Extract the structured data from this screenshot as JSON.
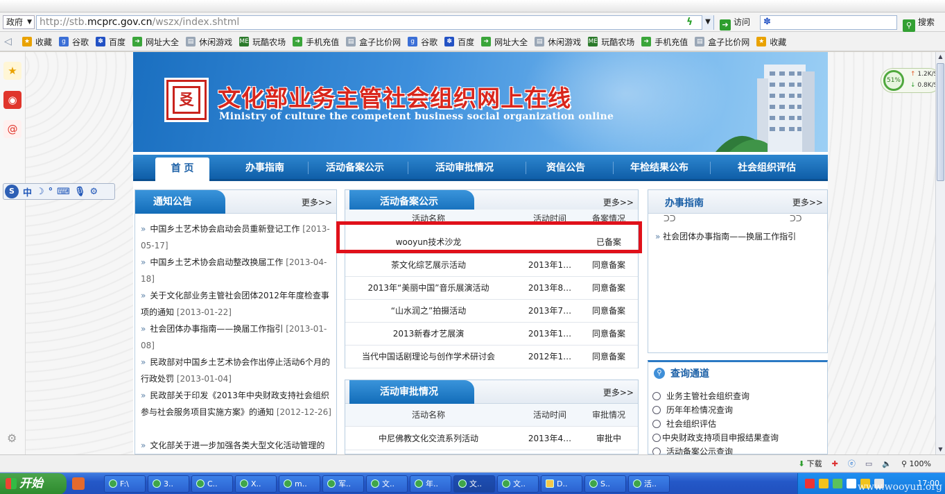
{
  "browser": {
    "gov_label": "政府",
    "url_prefix": "http://stb.",
    "url_domain": "mcprc.gov.cn",
    "url_path": "/wszx/index.shtml",
    "go_label": "访问",
    "search_label": "搜索"
  },
  "favorites": [
    {
      "label": "收藏",
      "icon": "star-icon",
      "color": "#e9a200"
    },
    {
      "label": "谷歌",
      "icon": "google-icon",
      "color": "#3b6fd6"
    },
    {
      "label": "百度",
      "icon": "baidu-paw-icon",
      "color": "#2352c4"
    },
    {
      "label": "网址大全",
      "icon": "hao123-icon",
      "color": "#3aa53a"
    },
    {
      "label": "休闲游戏",
      "icon": "page-icon",
      "color": "#9aa7b6"
    },
    {
      "label": "玩酷农场",
      "icon": "me-icon",
      "color": "#2b7a2b"
    },
    {
      "label": "手机充值",
      "icon": "hao123-icon",
      "color": "#3aa53a"
    },
    {
      "label": "盒子比价网",
      "icon": "page-icon",
      "color": "#9aa7b6"
    },
    {
      "label": "谷歌",
      "icon": "google-icon",
      "color": "#3b6fd6"
    },
    {
      "label": "百度",
      "icon": "baidu-paw-icon",
      "color": "#2352c4"
    },
    {
      "label": "网址大全",
      "icon": "hao123-icon",
      "color": "#3aa53a"
    },
    {
      "label": "休闲游戏",
      "icon": "page-icon",
      "color": "#9aa7b6"
    },
    {
      "label": "玩酷农场",
      "icon": "me-icon",
      "color": "#2b7a2b"
    },
    {
      "label": "手机充值",
      "icon": "hao123-icon",
      "color": "#3aa53a"
    },
    {
      "label": "盒子比价网",
      "icon": "page-icon",
      "color": "#9aa7b6"
    },
    {
      "label": "收藏",
      "icon": "star-icon",
      "color": "#e9a200"
    }
  ],
  "site": {
    "title": "文化部业务主管社会组织网上在线",
    "subtitle": "Ministry of culture the competent business social organization online",
    "nav": [
      "首 页",
      "办事指南",
      "活动备案公示",
      "活动审批情况",
      "资信公告",
      "年检结果公布",
      "社会组织评估"
    ]
  },
  "notice": {
    "title": "通知公告",
    "more": "更多>>",
    "items": [
      {
        "text": "中国乡土艺术协会启动会员重新登记工作",
        "date": "[2013-05-17]"
      },
      {
        "text": "中国乡土艺术协会启动整改换届工作",
        "date": "[2013-04-18]"
      },
      {
        "text": "关于文化部业务主管社会团体2012年年度检查事项的通知",
        "date": "[2013-01-22]"
      },
      {
        "text": "社会团体办事指南——换届工作指引",
        "date": "[2013-01-08]"
      },
      {
        "text": "民政部对中国乡土艺术协会作出停止活动6个月的行政处罚",
        "date": "[2013-01-04]"
      },
      {
        "text": "民政部关于印发《2013年中央财政支持社会组织参与社会服务项目实施方案》的通知",
        "date": "[2012-12-26]"
      },
      {
        "text": "文化部关于进一步加强各类大型文化活动管理的",
        "date": ""
      }
    ]
  },
  "filing": {
    "title": "活动备案公示",
    "more": "更多>>",
    "headers": {
      "name": "活动名称",
      "time": "活动时间",
      "status": "备案情况"
    },
    "rows": [
      {
        "name": "wooyun技术沙龙",
        "time": "",
        "status": "已备案"
      },
      {
        "name": "茶文化综艺展示活动",
        "time": "2013年1…",
        "status": "同意备案"
      },
      {
        "name": "2013年“美丽中国”音乐展演活动",
        "time": "2013年8…",
        "status": "同意备案"
      },
      {
        "name": "“山水润之”拍摄活动",
        "time": "2013年7…",
        "status": "同意备案"
      },
      {
        "name": "2013新春才艺展演",
        "time": "2013年1…",
        "status": "同意备案"
      },
      {
        "name": "当代中国话剧理论与创作学术研讨会",
        "time": "2012年1…",
        "status": "同意备案"
      }
    ]
  },
  "approval": {
    "title": "活动审批情况",
    "more": "更多>>",
    "headers": {
      "name": "活动名称",
      "time": "活动时间",
      "status": "审批情况"
    },
    "rows": [
      {
        "name": "中尼佛教文化交流系列活动",
        "time": "2013年4…",
        "status": "审批中"
      }
    ]
  },
  "guide": {
    "title": "办事指南",
    "more": "更多>>",
    "items": [
      "社会团体办事指南——换届工作指引"
    ]
  },
  "query": {
    "title": "查询通道",
    "items": [
      "业务主管社会组织查询",
      "历年年检情况查询",
      "社会组织评估",
      "中央财政支持项目申报结果查询",
      "活动备案公示查询"
    ]
  },
  "net": {
    "percent": "51%",
    "up": "1.2K/S",
    "down": "0.8K/S"
  },
  "status": {
    "download": "下载",
    "zoom": "100%"
  },
  "taskbar": {
    "start": "开始",
    "tasks": [
      "F:\\",
      "3..",
      "C..",
      "X..",
      "m..",
      "军..",
      "文..",
      "年..",
      "文..",
      "文..",
      "D..",
      "S..",
      "活.."
    ],
    "time": "17:00",
    "watermark": "www.wooyun.org"
  },
  "ime": {
    "mode": "中"
  }
}
